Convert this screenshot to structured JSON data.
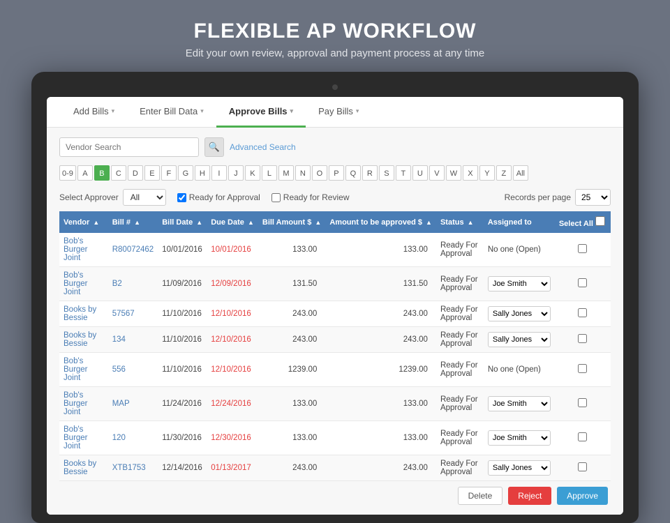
{
  "header": {
    "title": "FLEXIBLE AP WORKFLOW",
    "subtitle": "Edit your own review, approval and payment process at any time"
  },
  "nav": {
    "items": [
      {
        "label": "Add Bills",
        "active": false
      },
      {
        "label": "Enter Bill Data",
        "active": false
      },
      {
        "label": "Approve Bills",
        "active": true
      },
      {
        "label": "Pay Bills",
        "active": false
      }
    ]
  },
  "search": {
    "vendor_placeholder": "Vendor Search",
    "advanced_link": "Advanced Search"
  },
  "alpha": {
    "items": [
      "0-9",
      "A",
      "B",
      "C",
      "D",
      "E",
      "F",
      "G",
      "H",
      "I",
      "J",
      "K",
      "L",
      "M",
      "N",
      "O",
      "P",
      "Q",
      "R",
      "S",
      "T",
      "U",
      "V",
      "W",
      "X",
      "Y",
      "Z",
      "All"
    ],
    "active": "B"
  },
  "filters": {
    "select_approver_label": "Select Approver",
    "approver_value": "All",
    "ready_for_approval_label": "Ready for Approval",
    "ready_for_review_label": "Ready for Review",
    "records_per_page_label": "Records per page",
    "records_value": "25"
  },
  "table": {
    "columns": [
      "Vendor",
      "Bill #",
      "Bill Date",
      "Due Date",
      "Bill Amount $",
      "Amount to be approved $",
      "Status",
      "Assigned to",
      "Select All"
    ],
    "rows": [
      {
        "vendor": "Bob's Burger Joint",
        "bill_num": "R80072462",
        "bill_date": "10/01/2016",
        "due_date": "10/01/2016",
        "bill_amount": "133.00",
        "amount_approved": "133.00",
        "status": "Ready For Approval",
        "assigned": "No one (Open)",
        "assigned_type": "text"
      },
      {
        "vendor": "Bob's Burger Joint",
        "bill_num": "B2",
        "bill_date": "11/09/2016",
        "due_date": "12/09/2016",
        "bill_amount": "131.50",
        "amount_approved": "131.50",
        "status": "Ready For Approval",
        "assigned": "Joe Smith",
        "assigned_type": "select"
      },
      {
        "vendor": "Books by Bessie",
        "bill_num": "57567",
        "bill_date": "11/10/2016",
        "due_date": "12/10/2016",
        "bill_amount": "243.00",
        "amount_approved": "243.00",
        "status": "Ready For Approval",
        "assigned": "Sally Jones",
        "assigned_type": "select"
      },
      {
        "vendor": "Books by Bessie",
        "bill_num": "134",
        "bill_date": "11/10/2016",
        "due_date": "12/10/2016",
        "bill_amount": "243.00",
        "amount_approved": "243.00",
        "status": "Ready For Approval",
        "assigned": "Sally Jones",
        "assigned_type": "select"
      },
      {
        "vendor": "Bob's Burger Joint",
        "bill_num": "556",
        "bill_date": "11/10/2016",
        "due_date": "12/10/2016",
        "bill_amount": "1239.00",
        "amount_approved": "1239.00",
        "status": "Ready For Approval",
        "assigned": "No one (Open)",
        "assigned_type": "text"
      },
      {
        "vendor": "Bob's Burger Joint",
        "bill_num": "MAP",
        "bill_date": "11/24/2016",
        "due_date": "12/24/2016",
        "bill_amount": "133.00",
        "amount_approved": "133.00",
        "status": "Ready For Approval",
        "assigned": "Joe Smith",
        "assigned_type": "select"
      },
      {
        "vendor": "Bob's Burger Joint",
        "bill_num": "120",
        "bill_date": "11/30/2016",
        "due_date": "12/30/2016",
        "bill_amount": "133.00",
        "amount_approved": "133.00",
        "status": "Ready For Approval",
        "assigned": "Joe Smith",
        "assigned_type": "select"
      },
      {
        "vendor": "Books by Bessie",
        "bill_num": "XTB1753",
        "bill_date": "12/14/2016",
        "due_date": "01/13/2017",
        "bill_amount": "243.00",
        "amount_approved": "243.00",
        "status": "Ready For Approval",
        "assigned": "Sally Jones",
        "assigned_type": "select"
      }
    ]
  },
  "actions": {
    "delete_label": "Delete",
    "reject_label": "Reject",
    "approve_label": "Approve"
  }
}
